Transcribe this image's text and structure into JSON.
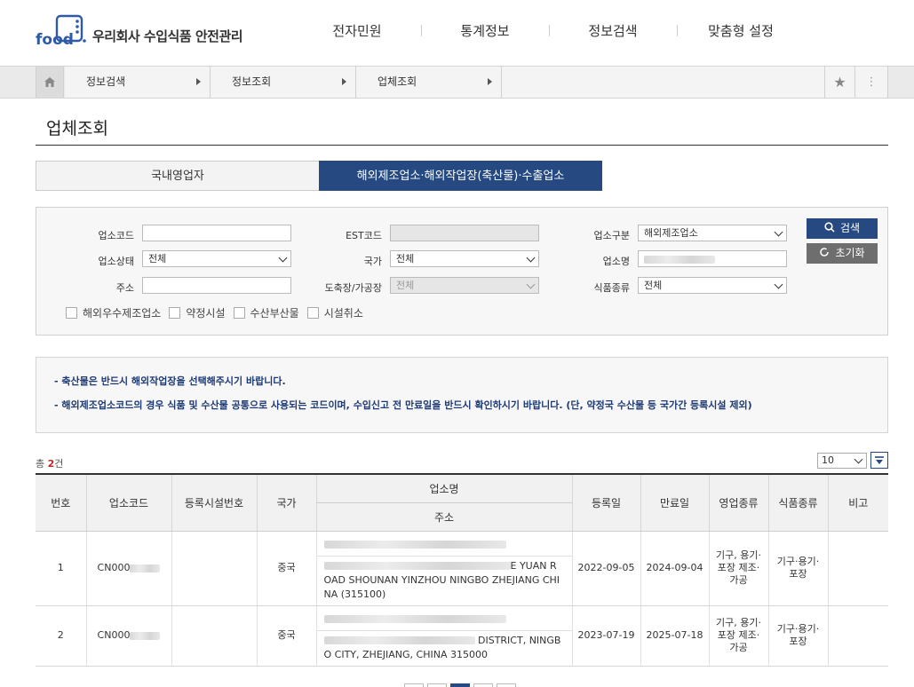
{
  "header": {
    "logo_text": "우리회사 수입식품 안전관리",
    "logo_word": "food",
    "gnb": [
      "전자민원",
      "통계정보",
      "정보검색",
      "맞춤형 설정"
    ]
  },
  "breadcrumb": {
    "items": [
      "정보검색",
      "정보조회",
      "업체조회"
    ]
  },
  "page": {
    "title": "업체조회"
  },
  "tabs": {
    "domestic": "국내영업자",
    "overseas": "해외제조업소·해외작업장(축산물)·수출업소",
    "active": "overseas"
  },
  "search": {
    "labels": {
      "code": "업소코드",
      "est": "EST코드",
      "category": "업소구분",
      "status": "업소상태",
      "country": "국가",
      "name": "업소명",
      "address": "주소",
      "slaughter": "도축장/가공장",
      "food_type": "식품종류"
    },
    "values": {
      "code": "",
      "est": "",
      "category": "해외제조업소",
      "status": "전체",
      "country": "전체",
      "address": "",
      "slaughter": "전체",
      "food_type": "전체"
    },
    "buttons": {
      "search": "검색",
      "reset": "초기화"
    },
    "checkboxes": [
      "해외우수제조업소",
      "약정시설",
      "수산부산물",
      "시설취소"
    ]
  },
  "notice": [
    "- 축산물은 반드시 해외작업장을 선택해주시기 바랍니다.",
    "- 해외제조업소코드의 경우 식품 및 수산물 공통으로 사용되는 코드이며, 수입신고 전 만료일을 반드시 확인하시기 바랍니다. (단, 약정국 수산물 등 국가간 등록시설 제외)"
  ],
  "result": {
    "total_prefix": "총 ",
    "total_count": "2",
    "total_suffix": "건",
    "page_size": "10"
  },
  "table": {
    "headers": {
      "no": "번호",
      "code": "업소코드",
      "reg_no": "등록시설번호",
      "country": "국가",
      "name": "업소명",
      "address": "주소",
      "reg_date": "등록일",
      "exp_date": "만료일",
      "biz_type": "영업종류",
      "food_type": "식품종류",
      "note": "비고"
    },
    "rows": [
      {
        "no": "1",
        "code": "CN000",
        "reg_no": "",
        "country": "중국",
        "address_visible": "E YUAN R OAD SHOUNAN YINZHOU NINGBO ZHEJIANG CHINA (315100)",
        "reg_date": "2022-09-05",
        "exp_date": "2024-09-04",
        "biz_type": "기구, 용기·포장 제조·가공",
        "food_type": "기구·용기·포장",
        "note": ""
      },
      {
        "no": "2",
        "code": "CN000",
        "reg_no": "",
        "country": "중국",
        "address_visible": "DISTRICT, NINGBO CITY, ZHEJIANG, CHINA 315000",
        "reg_date": "2023-07-19",
        "exp_date": "2025-07-18",
        "biz_type": "기구, 용기·포장 제조·가공",
        "food_type": "기구·용기·포장",
        "note": ""
      }
    ]
  },
  "colors": {
    "primary": "#254980",
    "accent_red": "#c62828",
    "notice_text": "#1e3a75"
  }
}
